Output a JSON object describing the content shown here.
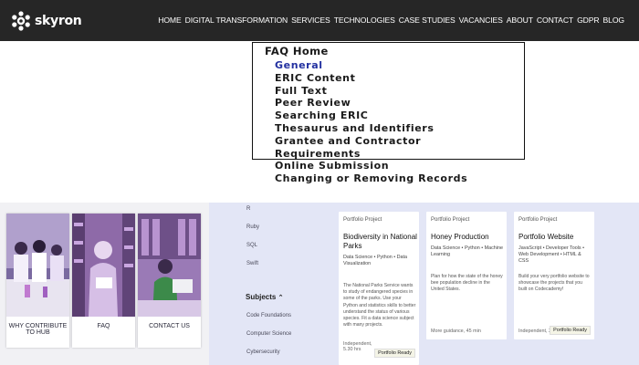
{
  "header": {
    "brand": "skyron",
    "nav": [
      "HOME",
      "DIGITAL TRANSFORMATION",
      "SERVICES",
      "TECHNOLOGIES",
      "CASE STUDIES",
      "VACANCIES",
      "ABOUT",
      "CONTACT",
      "GDPR",
      "BLOG"
    ]
  },
  "faq": {
    "home": "FAQ Home",
    "items": [
      {
        "label": "General",
        "active": true
      },
      {
        "label": "ERIC Content"
      },
      {
        "label": "Full Text"
      },
      {
        "label": "Peer Review"
      },
      {
        "label": "Searching ERIC"
      },
      {
        "label": "Thesaurus and Identifiers"
      },
      {
        "label": "Grantee and Contractor Requirements"
      },
      {
        "label": "Online Submission"
      },
      {
        "label": "Changing or Removing Records"
      }
    ]
  },
  "cards": [
    {
      "label": "WHY CONTRIBUTE TO HUB"
    },
    {
      "label": "FAQ"
    },
    {
      "label": "CONTACT US"
    }
  ],
  "filters": {
    "top_items": [
      "R",
      "Ruby",
      "SQL",
      "Swift"
    ],
    "subjects_heading": "Subjects",
    "subject_items": [
      "Code Foundations",
      "Computer Science",
      "Cybersecurity"
    ]
  },
  "projects": [
    {
      "tag": "Portfolio Project",
      "title": "Biodiversity in National Parks",
      "meta": "Data Science • Python • Data Visualization",
      "desc": "The National Parks Service wants to study of endangered species in some of the parks. Use your Python and statistics skills to better understand the status of various species. Fit a data science subject with many projects.",
      "foot": "Independent, 5.30 hrs",
      "badge": "Portfolio Ready"
    },
    {
      "tag": "Portfolio Project",
      "title": "Honey Production",
      "meta": "Data Science • Python • Machine Learning",
      "desc": "Plan for how the state of the honey bee population decline in the United States.",
      "foot": "More guidance, 45 min",
      "badge": ""
    },
    {
      "tag": "Portfolio Project",
      "title": "Portfolio Website",
      "meta": "JavaScript • Developer Tools • Web Development • HTML & CSS",
      "desc": "Build your very portfolio website to showcase the projects that you built on Codecademy!",
      "foot": "Independent, 3 hrs",
      "badge": "Portfolio Ready"
    }
  ],
  "colors": {
    "header_bg": "#262626",
    "faq_active": "#2230a0",
    "right_band": "#e3e6f6"
  }
}
